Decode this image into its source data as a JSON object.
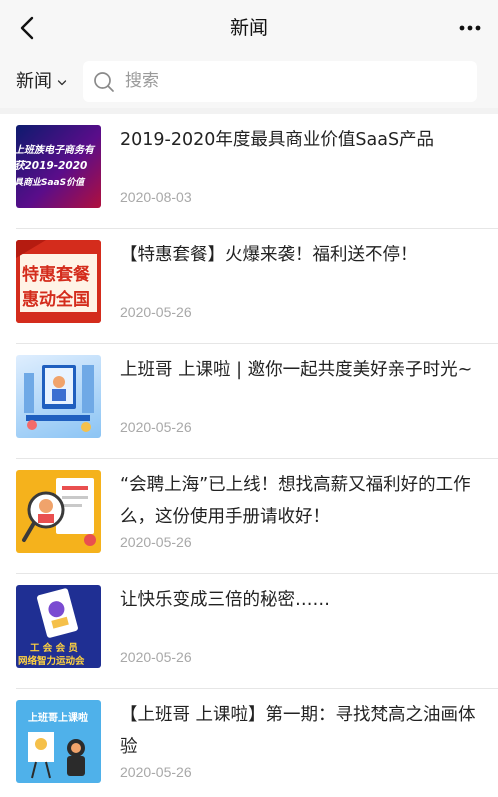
{
  "header": {
    "title": "新闻"
  },
  "filter": {
    "label": "新闻"
  },
  "search": {
    "placeholder": "搜索"
  },
  "thumbs": {
    "t1_line1": "上班族电子商务有",
    "t1_line2": "获2019-2020",
    "t1_line3": "具商业SaaS价值",
    "t2_line1": "特惠套餐",
    "t2_line2": "惠动全国",
    "t5_line1": "工 会 会 员",
    "t5_line2": "网络智力运动会",
    "t6_line1": "上班哥上课啦"
  },
  "articles": [
    {
      "title": "2019-2020年度最具商业价值SaaS产品",
      "date": "2020-08-03"
    },
    {
      "title": "【特惠套餐】火爆来袭！福利送不停！",
      "date": "2020-05-26"
    },
    {
      "title": "上班哥 上课啦 | 邀你一起共度美好亲子时光~",
      "date": "2020-05-26"
    },
    {
      "title": "“会聘上海”已上线！想找高薪又福利好的工作么，这份使用手册请收好！",
      "date": "2020-05-26"
    },
    {
      "title": "让快乐变成三倍的秘密……",
      "date": "2020-05-26"
    },
    {
      "title": "【上班哥 上课啦】第一期：寻找梵高之油画体验",
      "date": "2020-05-26"
    }
  ]
}
